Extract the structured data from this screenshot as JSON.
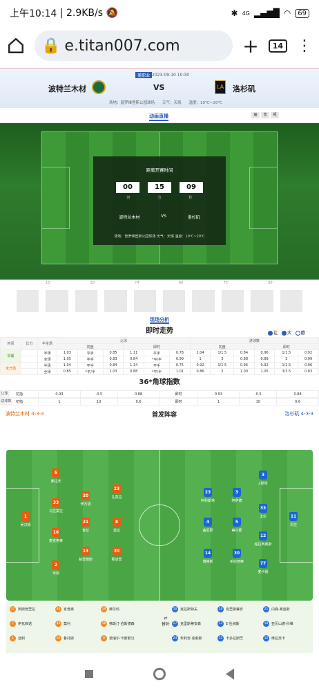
{
  "status": {
    "time": "上午10:14",
    "speed": "2.9KB/s",
    "battery": "69",
    "network": "4G"
  },
  "browser": {
    "url": "e.titan007.com",
    "tabs": "14"
  },
  "match": {
    "league": "美职业",
    "datetime": "2023-09-10 10:30",
    "home": "波特兰木材",
    "away": "洛杉矶",
    "vs": "VS",
    "info": "场地：普罗维登斯公园球场　　天气：天晴　　温度：19℃～20℃"
  },
  "live": {
    "tab": "动画直播",
    "opts": [
      "画",
      "音",
      "视"
    ]
  },
  "countdown": {
    "title": "距离开赛时间",
    "h": "00",
    "m": "15",
    "s": "09",
    "u1": "时",
    "u2": "分",
    "u3": "秒",
    "home": "波特兰木材",
    "vs": "VS",
    "away": "洛杉矶",
    "foot": "场地：普罗维登斯公园球场 天气：天晴 温度：19℃~20℃"
  },
  "timeline": [
    "15'",
    "30'",
    "HT",
    "60'",
    "75'",
    "90'"
  ],
  "analysis": {
    "tab": "现场分析"
  },
  "odds": {
    "title": "即时走势",
    "legend": [
      "让",
      "大",
      "欧"
    ],
    "h1": [
      "时间",
      "比分",
      "半全场",
      "让球",
      "进球数"
    ],
    "h2": [
      "初盘",
      "即时",
      "初盘",
      "即时"
    ],
    "rows": [
      {
        "t": "早餐",
        "k": "半场",
        "c": [
          "1.03",
          "平手",
          "0.85",
          "1.11",
          "平手",
          "0.78",
          "1.04",
          "1/1.5",
          "0.84",
          "0.96",
          "1/1.5",
          "0.92"
        ]
      },
      {
        "t": "",
        "k": "全场",
        "c": [
          "1.05",
          "半手",
          "0.83",
          "0.84",
          "*平/半",
          "0.99",
          "1",
          "3",
          "0.88",
          "0.89",
          "3",
          "0.99"
        ]
      },
      {
        "t": "未开场",
        "k": "半场",
        "c": [
          "1.04",
          "平手",
          "0.84",
          "1.14",
          "平手",
          "0.75",
          "0.92",
          "1/1.5",
          "0.96",
          "0.92",
          "1/1.5",
          "0.96"
        ]
      },
      {
        "t": "",
        "k": "全场",
        "c": [
          "0.85",
          "*平/半",
          "1.03",
          "0.88",
          "*平/半",
          "1.01",
          "0.86",
          "3",
          "1.00",
          "1.05",
          "3/3.5",
          "0.83"
        ]
      }
    ]
  },
  "corner": {
    "title": "36*角球指数",
    "s1": "让球",
    "s2": "进球数",
    "r1": [
      "初指",
      "0.93",
      "-0.5",
      "0.88",
      "即时",
      "0.93",
      "-0.5",
      "0.88"
    ],
    "r2": [
      "初指",
      "1",
      "10",
      "0.6",
      "即时",
      "1",
      "10",
      "0.6"
    ]
  },
  "lineup": {
    "title": "首发阵容",
    "home": "波特兰木材 4-3-3",
    "away": "洛杉矶 4-3-3",
    "homeP": [
      {
        "n": "1",
        "nm": "吴汉姆"
      },
      {
        "n": "5",
        "nm": "弗拉沃"
      },
      {
        "n": "33",
        "nm": "马拉莫拉"
      },
      {
        "n": "16",
        "nm": "麦克格莱"
      },
      {
        "n": "2",
        "nm": "米勒"
      },
      {
        "n": "20",
        "nm": "伊万诺"
      },
      {
        "n": "21",
        "nm": "查拉"
      },
      {
        "n": "13",
        "nm": "帕雷德斯"
      },
      {
        "n": "23",
        "nm": "扎莫拉"
      },
      {
        "n": "8",
        "nm": "莫拉"
      },
      {
        "n": "30",
        "nm": "穆诺雷"
      }
    ],
    "awayP": [
      {
        "n": "11",
        "nm": "贝拉"
      },
      {
        "n": "23",
        "nm": "阿科斯塔"
      },
      {
        "n": "3",
        "nm": "阿萨德"
      },
      {
        "n": "4",
        "nm": "塞尼耶"
      },
      {
        "n": "5",
        "nm": "蒂尔蒙"
      },
      {
        "n": "14",
        "nm": "博格斯"
      },
      {
        "n": "30",
        "nm": "帕拉西奥"
      },
      {
        "n": "3",
        "nm": "J·斯塔"
      },
      {
        "n": "33",
        "nm": "戈伦"
      },
      {
        "n": "12",
        "nm": "帕拉西奥斯"
      },
      {
        "n": "77",
        "nm": "麦卡锡"
      }
    ],
    "subsLabel": "替补",
    "homeSubs": [
      {
        "n": "17",
        "nm": "阿斯普里拉"
      },
      {
        "n": "44",
        "nm": "肖普奥"
      },
      {
        "n": "19",
        "nm": "弗尔科"
      },
      {
        "n": "7",
        "nm": "伊瓦西诺"
      },
      {
        "n": "49",
        "nm": "莫利"
      },
      {
        "n": "18",
        "nm": "弗斯汀·伯斯德森"
      },
      {
        "n": "1",
        "nm": "迪利"
      },
      {
        "n": "10",
        "nm": "鲁托斯"
      },
      {
        "n": "6",
        "nm": "诺瑞尔·卡斯斯汉"
      }
    ],
    "awaySubs": [
      {
        "n": "50",
        "nm": "克拉斯特夫"
      },
      {
        "n": "16",
        "nm": "克里斯蒂安"
      },
      {
        "n": "21",
        "nm": "内森·奥迪斯"
      },
      {
        "n": "27",
        "nm": "克里斯蒂安森"
      },
      {
        "n": "13",
        "nm": "E·杜纳斯"
      },
      {
        "n": "18",
        "nm": "亚历山德·科维"
      },
      {
        "n": "24",
        "nm": "朱利安·克莉斯"
      },
      {
        "n": "15",
        "nm": "卡多拉斯巴"
      },
      {
        "n": "10",
        "nm": "维拉苏卡"
      }
    ]
  }
}
